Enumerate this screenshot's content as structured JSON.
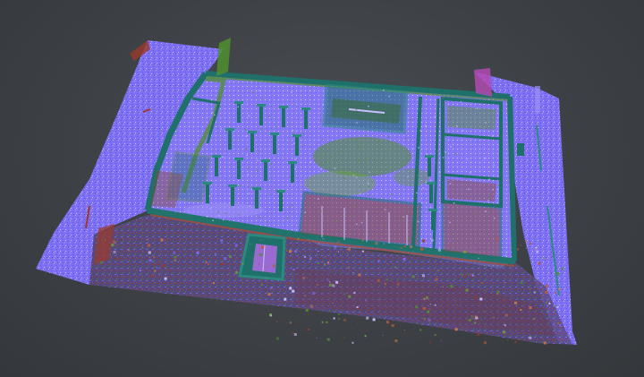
{
  "viewer": {
    "background_color": "#3f4347",
    "colors": {
      "ground": "#7c6df2",
      "ground_light": "#a79cf7",
      "ground_dark": "#5f52d6",
      "wall": "#1f6f6a",
      "wall_light": "#2a8a80",
      "vegetation": "#4f8f2e",
      "rust": "#8a4a32",
      "brick": "#a0523a",
      "debris_red": "#9a3a2a",
      "magenta": "#b04ab0"
    },
    "icons": [
      "point-cloud-scan"
    ]
  }
}
